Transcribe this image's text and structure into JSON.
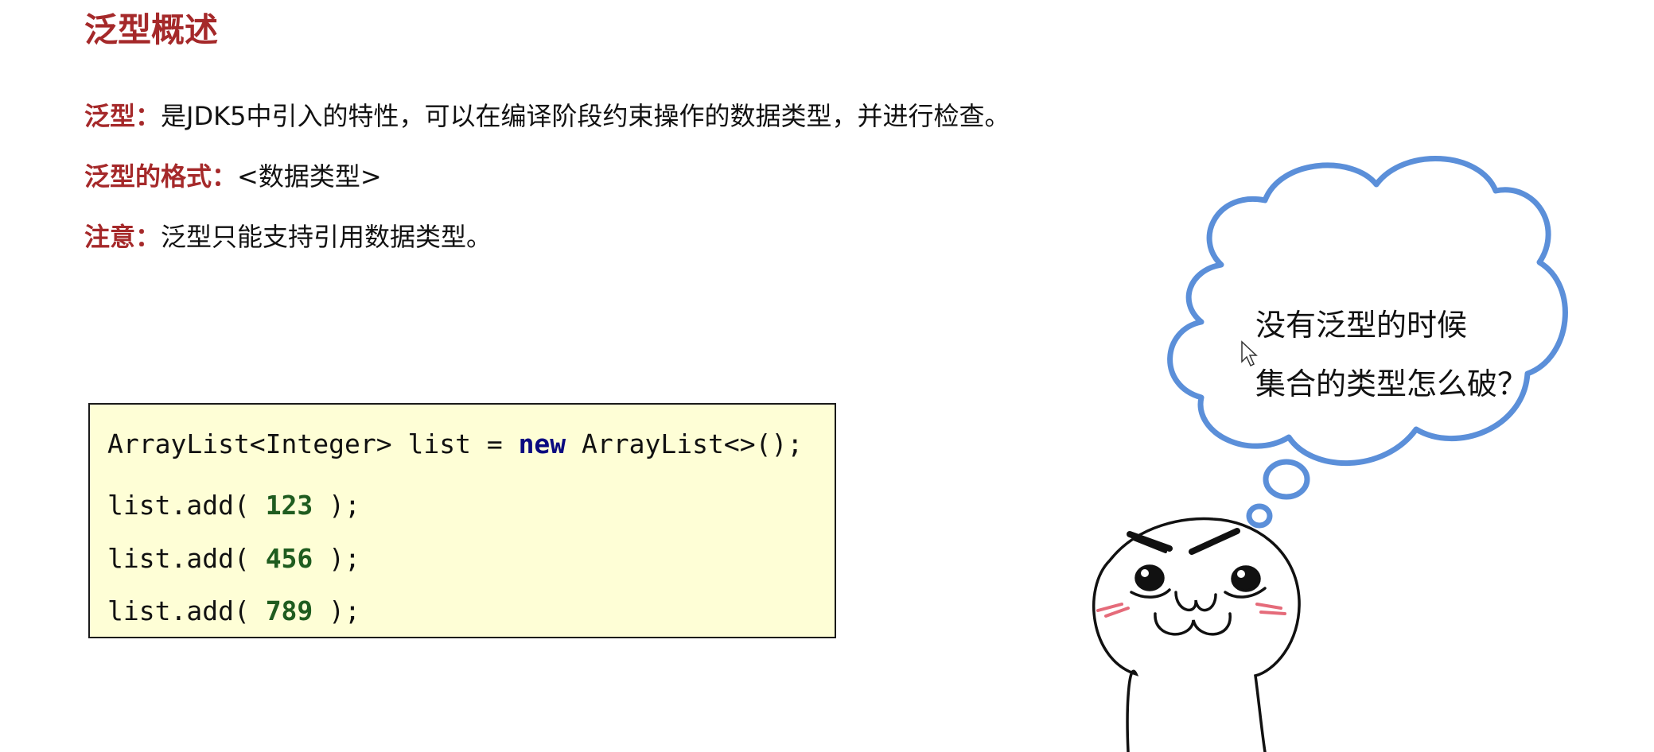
{
  "title": "泛型概述",
  "definition": {
    "label": "泛型：",
    "text": "是JDK5中引入的特性，可以在编译阶段约束操作的数据类型，并进行检查。"
  },
  "format": {
    "label": "泛型的格式：",
    "text": "<数据类型>"
  },
  "note": {
    "label": "注意：",
    "text": "泛型只能支持引用数据类型。"
  },
  "code": {
    "line1_pre": "ArrayList<Integer> list = ",
    "line1_kw": "new",
    "line1_post": " ArrayList<>();",
    "adds": [
      {
        "pre": "list.add( ",
        "num": "123",
        "post": " );"
      },
      {
        "pre": "list.add( ",
        "num": "456",
        "post": " );"
      },
      {
        "pre": "list.add( ",
        "num": "789",
        "post": " );"
      }
    ]
  },
  "thought": {
    "line1": "没有泛型的时候",
    "line2": "集合的类型怎么破？"
  },
  "colors": {
    "accent": "#a5292a",
    "code_bg": "#fefed6",
    "cloud": "#5b8fd9",
    "keyword": "#0a0a80",
    "number": "#1f5c1f"
  }
}
